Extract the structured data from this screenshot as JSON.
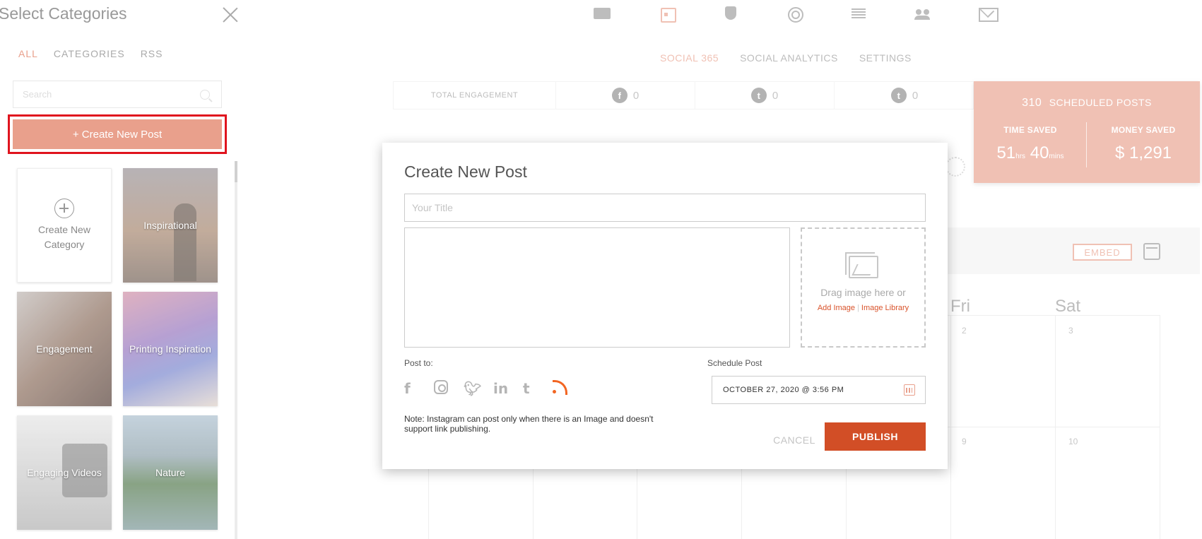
{
  "left_panel": {
    "title": "Select Categories",
    "tabs": [
      {
        "label": "ALL",
        "active": true
      },
      {
        "label": "CATEGORIES",
        "active": false
      },
      {
        "label": "RSS",
        "active": false
      }
    ],
    "search_placeholder": "Search",
    "create_post_label": "+ Create New Post",
    "tiles": [
      {
        "label": "Create New Category"
      },
      {
        "label": "Inspirational"
      },
      {
        "label": "Engagement"
      },
      {
        "label": "Printing Inspiration"
      },
      {
        "label": "Engaging Videos"
      },
      {
        "label": "Nature"
      }
    ]
  },
  "top_nav": {
    "icons": [
      "card-icon",
      "calendar-icon",
      "shield-icon",
      "target-icon",
      "align-icon",
      "users-icon",
      "mail-icon"
    ],
    "tabs": [
      {
        "label": "SOCIAL 365",
        "active": true
      },
      {
        "label": "SOCIAL ANALYTICS",
        "active": false
      },
      {
        "label": "SETTINGS",
        "active": false
      }
    ]
  },
  "stats": {
    "total_label": "TOTAL ENGAGEMENT",
    "facebook": "0",
    "twitter": "0",
    "tumblr": "0",
    "fb_glyph": "f",
    "tw_glyph": "t",
    "tu_glyph": "t"
  },
  "scheduled": {
    "count": "310",
    "label": "SCHEDULED POSTS",
    "time_label": "TIME SAVED",
    "hours": "51",
    "hrs_unit": "hrs",
    "mins": "40",
    "mins_unit": "mins",
    "money_label": "MONEY SAVED",
    "money": "$ 1,291"
  },
  "calendar": {
    "embed_label": "EMBED",
    "days": [
      "Fri",
      "Sat"
    ],
    "numbers": [
      "2",
      "3",
      "9",
      "10"
    ]
  },
  "modal": {
    "title": "Create New Post",
    "title_placeholder": "Your Title",
    "drag_text": "Drag image here or",
    "add_image": "Add Image",
    "image_library": "Image Library",
    "post_to_label": "Post to:",
    "networks": [
      "facebook-icon",
      "instagram-icon",
      "twitter-icon",
      "linkedin-icon",
      "tumblr-icon",
      "rss-icon"
    ],
    "note": "Note: Instagram can post only when there is an Image and doesn't support link publishing.",
    "schedule_label": "Schedule Post",
    "schedule_value": "OCTOBER 27, 2020 @ 3:56 PM",
    "cancel_label": "CANCEL",
    "publish_label": "PUBLISH"
  },
  "colors": {
    "accent": "#e9a08c",
    "publish": "#d24e26",
    "highlight_frame": "#e0141e",
    "rss": "#f26522"
  }
}
